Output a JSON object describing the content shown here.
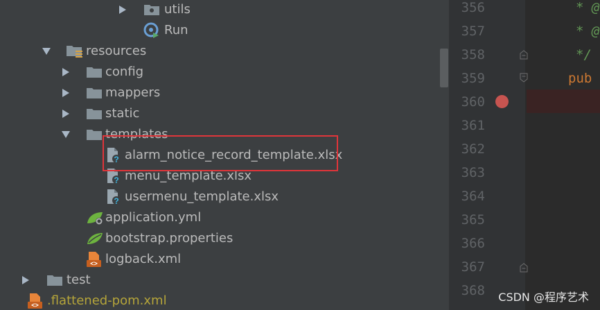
{
  "tree": [
    {
      "label": "utils",
      "icon": "package-folder-icon",
      "arrow": "right"
    },
    {
      "label": "Run",
      "icon": "run-config-icon",
      "arrow": ""
    },
    {
      "label": "resources",
      "icon": "resources-folder-icon",
      "arrow": "down"
    },
    {
      "label": "config",
      "icon": "folder-icon",
      "arrow": "right"
    },
    {
      "label": "mappers",
      "icon": "folder-icon",
      "arrow": "right"
    },
    {
      "label": "static",
      "icon": "folder-icon",
      "arrow": "right"
    },
    {
      "label": "templates",
      "icon": "folder-icon",
      "arrow": "down"
    },
    {
      "label": "alarm_notice_record_template.xlsx",
      "icon": "unknown-file-icon",
      "arrow": ""
    },
    {
      "label": "menu_template.xlsx",
      "icon": "unknown-file-icon",
      "arrow": ""
    },
    {
      "label": "usermenu_template.xlsx",
      "icon": "unknown-file-icon",
      "arrow": ""
    },
    {
      "label": "application.yml",
      "icon": "spring-config-icon",
      "arrow": ""
    },
    {
      "label": "bootstrap.properties",
      "icon": "spring-leaf-icon",
      "arrow": ""
    },
    {
      "label": "logback.xml",
      "icon": "xml-file-icon",
      "arrow": ""
    },
    {
      "label": "test",
      "icon": "folder-icon",
      "arrow": "right"
    },
    {
      "label": ".flattened-pom.xml",
      "icon": "xml-file-icon",
      "arrow": ""
    }
  ],
  "editor": {
    "line_numbers": [
      "356",
      "357",
      "358",
      "359",
      "360",
      "361",
      "362",
      "363",
      "364",
      "365",
      "366",
      "367",
      "368"
    ],
    "code_lines": [
      {
        "line": "356",
        "text": "* @"
      },
      {
        "line": "357",
        "text": "* @"
      },
      {
        "line": "358",
        "text": "*/"
      },
      {
        "line": "359",
        "text": "pub"
      }
    ],
    "breakpoint_line": "360"
  },
  "watermark": "CSDN @程序艺术",
  "colors": {
    "tree_bg": "#3c3f41",
    "editor_bg": "#2b2b2b",
    "highlight": "#e0353a",
    "breakpoint": "#c75450",
    "javadoc": "#629755",
    "keyword": "#cc7832"
  }
}
